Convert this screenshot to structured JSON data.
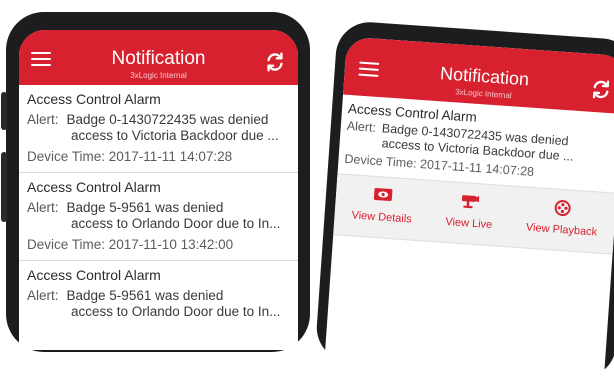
{
  "colors": {
    "accent": "#d8212f",
    "phone_frame": "#1d1d1f"
  },
  "left_phone": {
    "header": {
      "menu_icon": "hamburger-icon",
      "title": "Notification",
      "subtitle": "3xLogic Internal",
      "refresh_icon": "refresh-icon"
    },
    "notifications": [
      {
        "title": "Access Control Alarm",
        "alert_label": "Alert:",
        "alert_line1": "Badge 0-1430722435  was denied",
        "alert_line2": "access to Victoria Backdoor due ...",
        "device_time": "Device Time: 2017-11-11 14:07:28"
      },
      {
        "title": "Access Control Alarm",
        "alert_label": "Alert:",
        "alert_line1": "Badge 5-9561  was denied",
        "alert_line2": "access to Orlando Door due to In...",
        "device_time": "Device Time: 2017-11-10 13:42:00"
      },
      {
        "title": "Access Control Alarm",
        "alert_label": "Alert:",
        "alert_line1": "Badge 5-9561  was denied",
        "alert_line2": "access to Orlando Door due to In..."
      }
    ]
  },
  "right_phone": {
    "header": {
      "menu_icon": "hamburger-icon",
      "title": "Notification",
      "subtitle": "3xLogic Internal",
      "refresh_icon": "refresh-icon"
    },
    "notification": {
      "title": "Access Control Alarm",
      "alert_label": "Alert:",
      "alert_line1": "Badge 0-1430722435  was denied",
      "alert_line2": "access to Victoria Backdoor due ...",
      "device_time": "Device Time: 2017-11-11 14:07:28"
    },
    "actions": [
      {
        "label": "View Details",
        "icon": "eye-icon"
      },
      {
        "label": "View Live",
        "icon": "camera-icon"
      },
      {
        "label": "View Playback",
        "icon": "film-reel-icon"
      }
    ]
  }
}
